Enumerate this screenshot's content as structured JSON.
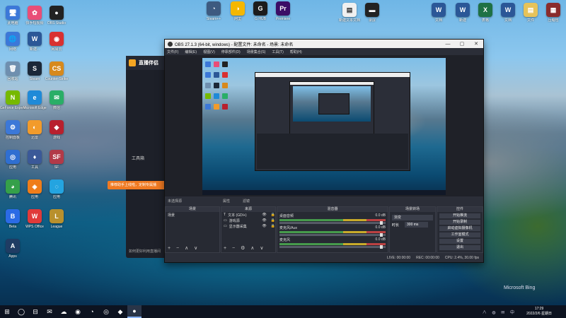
{
  "desktop": {
    "icons": [
      {
        "id": "computer",
        "label": "此电脑",
        "glyph": "🖥",
        "color": "#3c78d8"
      },
      {
        "id": "kuaisou",
        "label": "快手短视频",
        "glyph": "✿",
        "color": "#e94e77"
      },
      {
        "id": "obs",
        "label": "OBS Studio",
        "glyph": "●",
        "color": "#222"
      },
      {
        "id": "net",
        "label": "网络",
        "glyph": "🌐",
        "color": "#3c78d8"
      },
      {
        "id": "word1",
        "label": "新建...",
        "glyph": "W",
        "color": "#2b5797"
      },
      {
        "id": "netease",
        "label": "网易云",
        "glyph": "◉",
        "color": "#d93030"
      },
      {
        "id": "bin",
        "label": "回收站",
        "glyph": "🗑",
        "color": "#6f8faf"
      },
      {
        "id": "steam",
        "label": "Steam",
        "glyph": "S",
        "color": "#1b2838"
      },
      {
        "id": "cs",
        "label": "Counter-Strike",
        "glyph": "CS",
        "color": "#d7891c"
      },
      {
        "id": "nvidia",
        "label": "GeForce Experience",
        "glyph": "N",
        "color": "#76b900"
      },
      {
        "id": "edge",
        "label": "Microsoft Edge",
        "glyph": "e",
        "color": "#1f8ad8"
      },
      {
        "id": "wechat",
        "label": "微信",
        "glyph": "✉",
        "color": "#2aae67"
      },
      {
        "id": "control",
        "label": "控制面板",
        "glyph": "⚙",
        "color": "#3c78d8"
      },
      {
        "id": "browser",
        "label": "迅雷",
        "glyph": "◐",
        "color": "#f29b2b"
      },
      {
        "id": "game1",
        "label": "游戏",
        "glyph": "◆",
        "color": "#b8202e"
      },
      {
        "id": "app2",
        "label": "应用",
        "glyph": "◎",
        "color": "#2f6fd1"
      },
      {
        "id": "tool",
        "label": "工具",
        "glyph": "♦",
        "color": "#3b5998"
      },
      {
        "id": "sf",
        "label": "SF",
        "glyph": "SF",
        "color": "#b23a48"
      },
      {
        "id": "app3",
        "label": "腾讯",
        "glyph": "◕",
        "color": "#35a04a"
      },
      {
        "id": "app4",
        "label": "应用",
        "glyph": "◈",
        "color": "#ef7d1a"
      },
      {
        "id": "app5",
        "label": "应用",
        "glyph": "◌",
        "color": "#24a4e0"
      },
      {
        "id": "app6",
        "label": "Beta",
        "glyph": "B",
        "color": "#2b6be5"
      },
      {
        "id": "wps",
        "label": "WPS Office",
        "glyph": "W",
        "color": "#e03a3a"
      },
      {
        "id": "lol",
        "label": "League",
        "glyph": "L",
        "color": "#b8902d"
      },
      {
        "id": "lumi",
        "label": "Apps",
        "glyph": "A",
        "color": "#1f3c63"
      }
    ],
    "top_icons": [
      {
        "id": "t1",
        "label": "Steam++",
        "glyph": "◔",
        "color": "#3d5a80"
      },
      {
        "id": "t2",
        "label": "阿里",
        "glyph": "◑",
        "color": "#f5b700"
      },
      {
        "id": "t3",
        "label": "G HUB",
        "glyph": "G",
        "color": "#1c1c1c"
      },
      {
        "id": "t4",
        "label": "Premiere",
        "glyph": "Pr",
        "color": "#3b0d66"
      },
      {
        "id": "t5",
        "label": "新建文本文档",
        "glyph": "▤",
        "color": "#f0f0f0"
      },
      {
        "id": "t6",
        "label": "录屏",
        "glyph": "▬",
        "color": "#222"
      },
      {
        "id": "t7",
        "label": "文档",
        "glyph": "W",
        "color": "#2b5797"
      },
      {
        "id": "t8",
        "label": "新建",
        "glyph": "W",
        "color": "#2b5797"
      },
      {
        "id": "t9",
        "label": "表格",
        "glyph": "X",
        "color": "#1e7145"
      },
      {
        "id": "t10",
        "label": "文档",
        "glyph": "W",
        "color": "#2b5797"
      },
      {
        "id": "t11",
        "label": "文件",
        "glyph": "▤",
        "color": "#e6c35a"
      },
      {
        "id": "t12",
        "label": "压缩包",
        "glyph": "▦",
        "color": "#8a2c2c"
      }
    ]
  },
  "live_app": {
    "title": "直播伴侣",
    "tools_label": "工具箱",
    "notice": "推荐助手上线啦，定制专属播",
    "footer": "如何更好利用直播间"
  },
  "obs": {
    "title": "OBS 27.1.3 (64-bit, windows) - 配置文件: 未命名 - 场景: 未命名",
    "menu": [
      "文件(F)",
      "编辑(E)",
      "视图(V)",
      "停靠部件(D)",
      "场景集合(S)",
      "工具(T)",
      "帮助(H)"
    ],
    "toolbar": {
      "no_source": "未选择源",
      "properties": "属性",
      "filters": "滤镜"
    },
    "docks": {
      "scenes": {
        "title": "场景",
        "items": [
          "场景"
        ]
      },
      "sources": {
        "title": "来源",
        "items": [
          {
            "icon": "T",
            "name": "文本 (GDI+)"
          },
          {
            "icon": "▭",
            "name": "游戏源"
          },
          {
            "icon": "▭",
            "name": "显示器采集"
          }
        ]
      },
      "mixer": {
        "title": "混音器",
        "channels": [
          {
            "name": "桌面音频",
            "level": "0.0 dB"
          },
          {
            "name": "麦克风/Aux",
            "level": "0.0 dB"
          },
          {
            "name": "麦克风",
            "level": "0.0 dB"
          }
        ]
      },
      "transitions": {
        "title": "场景转场",
        "selected": "渐变",
        "duration_label": "时长",
        "duration": "300 ms"
      },
      "controls": {
        "title": "控件",
        "buttons": [
          "开始推流",
          "开始录制",
          "启动虚拟摄像机",
          "工作室模式",
          "设置",
          "退出"
        ]
      }
    },
    "status": {
      "live": "LIVE: 00:00:00",
      "rec": "REC: 00:00:00",
      "cpu": "CPU: 2.4%, 30.00 fps"
    }
  },
  "watermark": "Microsoft Bing",
  "taskbar": {
    "apps": [
      "⊞",
      "◯",
      "⊟",
      "✉",
      "☁",
      "◉",
      "◔",
      "◎",
      "◆",
      "●"
    ],
    "tray": "∧ ◍ ✉ 中",
    "time": "17:29",
    "date": "2022/2/6 星期日"
  }
}
